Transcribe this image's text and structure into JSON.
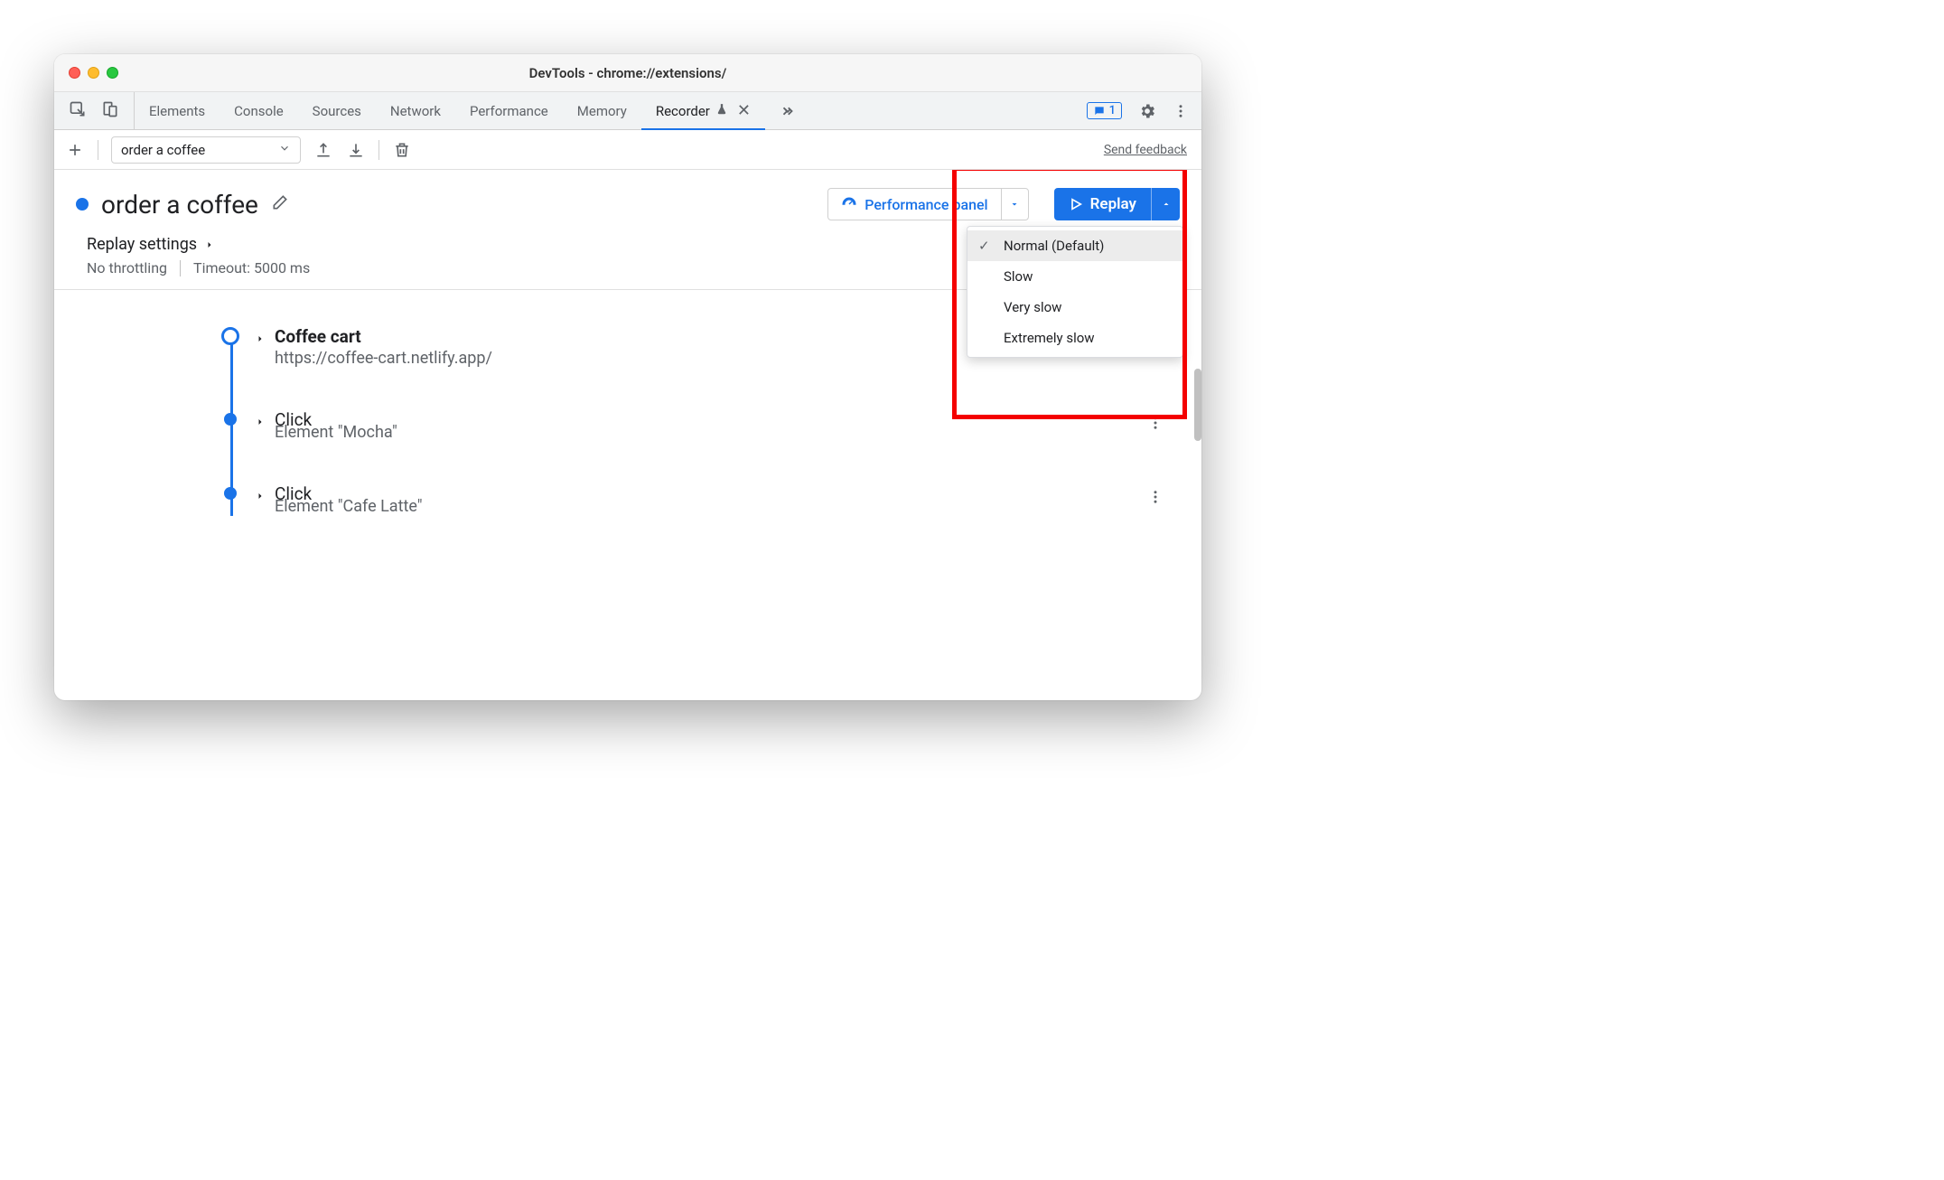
{
  "window": {
    "title": "DevTools - chrome://extensions/"
  },
  "tabs": {
    "items": [
      "Elements",
      "Console",
      "Sources",
      "Network",
      "Performance",
      "Memory",
      "Recorder"
    ],
    "active": "Recorder",
    "message_count": "1"
  },
  "toolbar": {
    "recording_name": "order a coffee",
    "feedback": "Send feedback"
  },
  "header": {
    "recording_title": "order a coffee",
    "perf_label": "Performance panel",
    "replay_label": "Replay"
  },
  "speed_menu": {
    "items": [
      {
        "label": "Normal (Default)",
        "selected": true
      },
      {
        "label": "Slow",
        "selected": false
      },
      {
        "label": "Very slow",
        "selected": false
      },
      {
        "label": "Extremely slow",
        "selected": false
      }
    ]
  },
  "settings": {
    "title": "Replay settings",
    "throttling": "No throttling",
    "timeout": "Timeout: 5000 ms"
  },
  "steps": [
    {
      "title": "Coffee cart",
      "subtitle": "https://coffee-cart.netlify.app/",
      "first": true,
      "bold": true
    },
    {
      "title": "Click",
      "subtitle": "Element \"Mocha\"",
      "first": false,
      "bold": false
    },
    {
      "title": "Click",
      "subtitle": "Element \"Cafe Latte\"",
      "first": false,
      "bold": false
    }
  ]
}
